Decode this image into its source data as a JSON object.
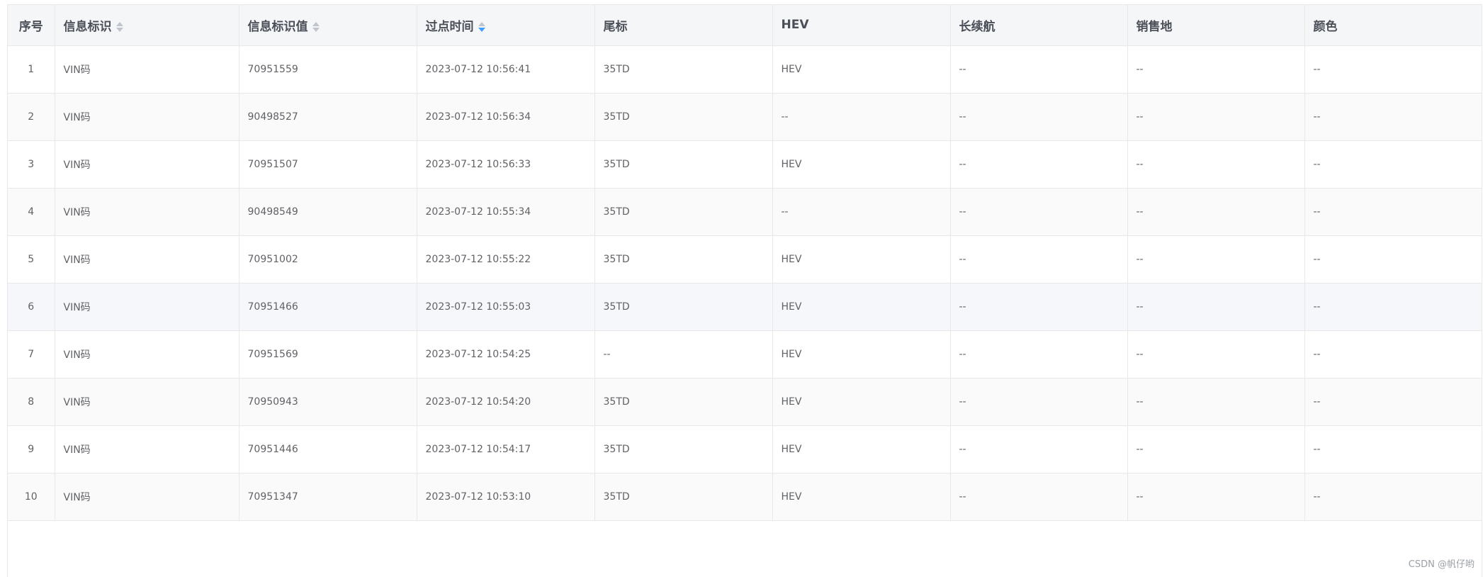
{
  "table": {
    "headers": [
      {
        "label": "序号",
        "sortable": false
      },
      {
        "label": "信息标识",
        "sortable": true
      },
      {
        "label": "信息标识值",
        "sortable": true
      },
      {
        "label": "过点时间",
        "sortable": true,
        "sort_state": "descending"
      },
      {
        "label": "尾标",
        "sortable": false
      },
      {
        "label": "HEV",
        "sortable": false
      },
      {
        "label": "长续航",
        "sortable": false
      },
      {
        "label": "销售地",
        "sortable": false
      },
      {
        "label": "颜色",
        "sortable": false
      }
    ],
    "rows": [
      [
        "1",
        "VIN码",
        "70951559",
        "2023-07-12 10:56:41",
        "35TD",
        "HEV",
        "--",
        "--",
        "--"
      ],
      [
        "2",
        "VIN码",
        "90498527",
        "2023-07-12 10:56:34",
        "35TD",
        "--",
        "--",
        "--",
        "--"
      ],
      [
        "3",
        "VIN码",
        "70951507",
        "2023-07-12 10:56:33",
        "35TD",
        "HEV",
        "--",
        "--",
        "--"
      ],
      [
        "4",
        "VIN码",
        "90498549",
        "2023-07-12 10:55:34",
        "35TD",
        "--",
        "--",
        "--",
        "--"
      ],
      [
        "5",
        "VIN码",
        "70951002",
        "2023-07-12 10:55:22",
        "35TD",
        "HEV",
        "--",
        "--",
        "--"
      ],
      [
        "6",
        "VIN码",
        "70951466",
        "2023-07-12 10:55:03",
        "35TD",
        "HEV",
        "--",
        "--",
        "--"
      ],
      [
        "7",
        "VIN码",
        "70951569",
        "2023-07-12 10:54:25",
        "--",
        "HEV",
        "--",
        "--",
        "--"
      ],
      [
        "8",
        "VIN码",
        "70950943",
        "2023-07-12 10:54:20",
        "35TD",
        "HEV",
        "--",
        "--",
        "--"
      ],
      [
        "9",
        "VIN码",
        "70951446",
        "2023-07-12 10:54:17",
        "35TD",
        "HEV",
        "--",
        "--",
        "--"
      ],
      [
        "10",
        "VIN码",
        "70951347",
        "2023-07-12 10:53:10",
        "35TD",
        "HEV",
        "--",
        "--",
        "--"
      ]
    ]
  },
  "watermark": "CSDN @帆仔哟",
  "colors": {
    "header_bg": "#f5f6f8",
    "stripe_bg": "#fafafa",
    "hover_bg": "#f5f7fa",
    "border": "#e8e8e8",
    "sort_active": "#409eff",
    "sort_inactive": "#c0c4cc"
  }
}
